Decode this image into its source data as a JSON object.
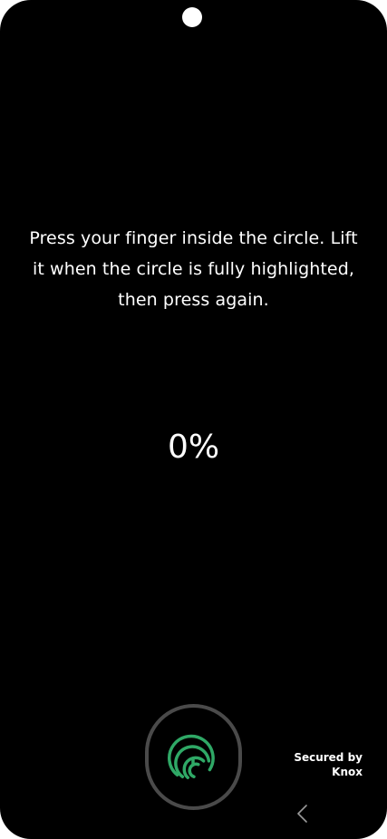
{
  "instruction": {
    "text": "Press your finger inside the circle. Lift it when the circle is fully highlighted, then press again."
  },
  "progress": {
    "percent_label": "0%",
    "value": 0
  },
  "sensor": {
    "icon": "fingerprint-icon",
    "icon_color": "#2fa866",
    "ring_color": "#4a4a4a"
  },
  "knox": {
    "line1": "Secured by",
    "line2": "Knox"
  },
  "navigation": {
    "back_icon": "chevron-left-icon"
  },
  "colors": {
    "background": "#000000",
    "text": "#ffffff",
    "accent": "#2fa866"
  }
}
